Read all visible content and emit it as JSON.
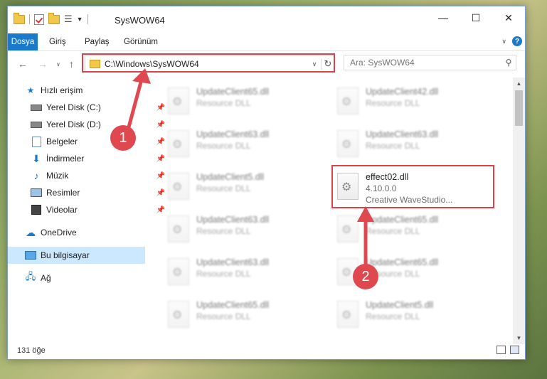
{
  "window": {
    "title": "SysWOW64"
  },
  "ribbon": {
    "tabs": [
      "Dosya",
      "Giriş",
      "Paylaş",
      "Görünüm"
    ]
  },
  "address": {
    "path": "C:\\Windows\\SysWOW64"
  },
  "search": {
    "placeholder": "Ara: SysWOW64"
  },
  "sidebar": {
    "items": [
      {
        "label": "Hızlı erişim",
        "icon": "star-icon"
      },
      {
        "label": "Yerel Disk (C:)",
        "icon": "drive-icon",
        "pinned": true
      },
      {
        "label": "Yerel Disk (D:)",
        "icon": "drive-icon",
        "pinned": true
      },
      {
        "label": "Belgeler",
        "icon": "documents-icon",
        "pinned": true
      },
      {
        "label": "İndirmeler",
        "icon": "download-icon",
        "pinned": true
      },
      {
        "label": "Müzik",
        "icon": "music-icon",
        "pinned": true
      },
      {
        "label": "Resimler",
        "icon": "pictures-icon",
        "pinned": true
      },
      {
        "label": "Videolar",
        "icon": "videos-icon",
        "pinned": true
      },
      {
        "label": "OneDrive",
        "icon": "cloud-icon"
      },
      {
        "label": "Bu bilgisayar",
        "icon": "computer-icon",
        "selected": true
      },
      {
        "label": "Ağ",
        "icon": "network-icon"
      }
    ]
  },
  "files": [
    {
      "name": "UpdateClient65.dll",
      "sub": "Resource DLL",
      "blurred": true
    },
    {
      "name": "UpdateClient42.dll",
      "sub": "Resource DLL",
      "blurred": true
    },
    {
      "name": "UpdateClient63.dll",
      "sub": "Resource DLL",
      "blurred": true
    },
    {
      "name": "UpdateClient63.dll",
      "sub": "Resource DLL",
      "blurred": true
    },
    {
      "name": "UpdateClient5.dll",
      "sub": "Resource DLL",
      "blurred": true
    },
    {
      "name": "effect02.dll",
      "version": "4.10.0.0",
      "sub": "Creative WaveStudio...",
      "blurred": false
    },
    {
      "name": "UpdateClient63.dll",
      "sub": "Resource DLL",
      "blurred": true
    },
    {
      "name": "UpdateClient65.dll",
      "sub": "Resource DLL",
      "blurred": true
    },
    {
      "name": "UpdateClient63.dll",
      "sub": "Resource DLL",
      "blurred": true
    },
    {
      "name": "UpdateClient65.dll",
      "sub": "Resource DLL",
      "blurred": true
    },
    {
      "name": "UpdateClient65.dll",
      "sub": "Resource DLL",
      "blurred": true
    },
    {
      "name": "UpdateClient5.dll",
      "sub": "Resource DLL",
      "blurred": true
    }
  ],
  "status": {
    "count": "131 öğe"
  },
  "annotations": {
    "step1": "1",
    "step2": "2"
  },
  "colors": {
    "accent": "#1979ca",
    "highlight": "#d9424a",
    "selected": "#cce8ff"
  }
}
